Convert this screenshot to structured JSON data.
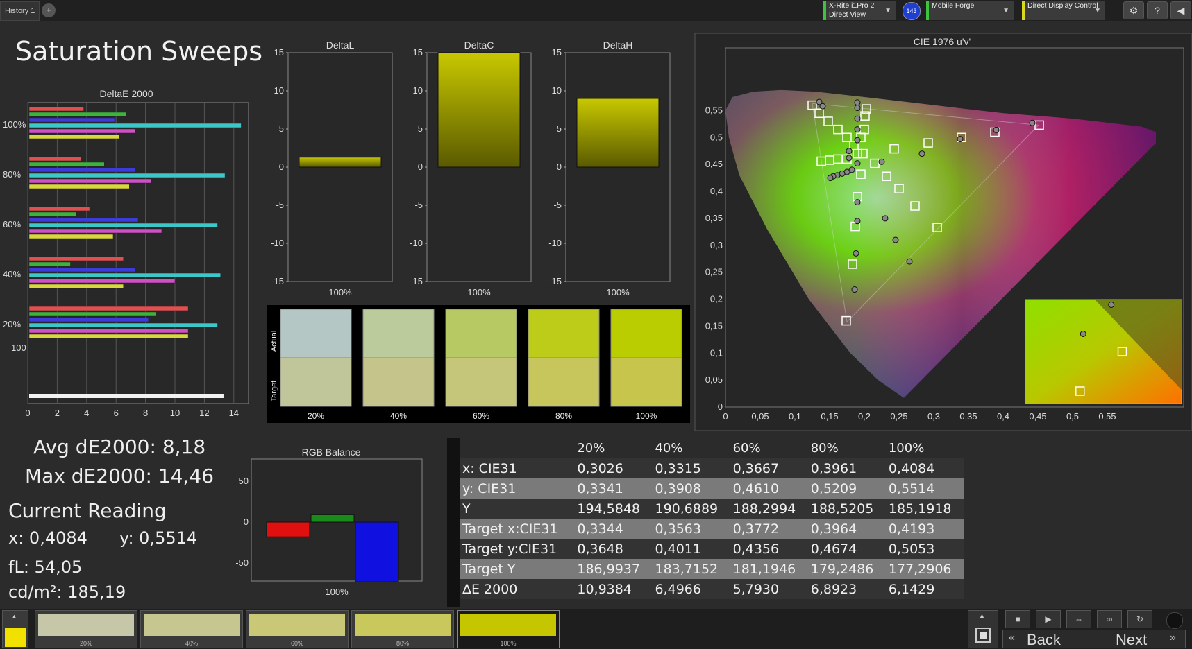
{
  "top": {
    "tab_label": "History 1",
    "tab_add": "+",
    "devices": [
      {
        "line1": "X-Rite i1Pro 2",
        "line2": "Direct View"
      },
      {
        "line1": "Mobile Forge",
        "line2": ""
      },
      {
        "line1": "Direct Display Control",
        "line2": ""
      }
    ],
    "badge": "143",
    "settings_icon": "gear-icon",
    "help_label": "?",
    "back_label": "◀"
  },
  "page": {
    "title": "Saturation Sweeps"
  },
  "de_chart": {
    "title": "DeltaE 2000",
    "type": "bar",
    "xticks": [
      "0",
      "2",
      "4",
      "6",
      "8",
      "10",
      "12",
      "14"
    ],
    "xlim": [
      0,
      15
    ],
    "group_labels": [
      "100%",
      "80%",
      "60%",
      "40%",
      "20%",
      "100"
    ],
    "series_colors": [
      "#e05050",
      "#3cb43c",
      "#3c3cd8",
      "#3cc8c8",
      "#d050c8",
      "#d8d83c"
    ],
    "groups": [
      {
        "label": "100%",
        "values": [
          3.8,
          6.7,
          5.9,
          14.5,
          7.3,
          6.2
        ]
      },
      {
        "label": "80%",
        "values": [
          3.6,
          5.2,
          7.3,
          13.4,
          8.4,
          6.9
        ]
      },
      {
        "label": "60%",
        "values": [
          4.2,
          3.3,
          7.5,
          12.9,
          9.1,
          5.8
        ]
      },
      {
        "label": "40%",
        "values": [
          6.5,
          2.9,
          7.3,
          13.1,
          10.0,
          6.5
        ]
      },
      {
        "label": "20%",
        "values": [
          10.9,
          8.7,
          8.2,
          12.9,
          10.9,
          10.9
        ]
      }
    ],
    "white_value": 13.3
  },
  "delta_charts": [
    {
      "title": "DeltaL",
      "value": 1.3,
      "label": "100%"
    },
    {
      "title": "DeltaC",
      "value": 15,
      "label": "100%"
    },
    {
      "title": "DeltaH",
      "value": 9,
      "label": "100%"
    }
  ],
  "delta_yticks": [
    "15",
    "10",
    "5",
    "0",
    "-5",
    "-10",
    "-15"
  ],
  "swatches": {
    "row_actual": "Actual",
    "row_target": "Target",
    "items": [
      {
        "label": "20%",
        "actual": "#b4c7c4",
        "target": "#c1c59a"
      },
      {
        "label": "40%",
        "actual": "#bccb9b",
        "target": "#c4c48b"
      },
      {
        "label": "60%",
        "actual": "#b7c962",
        "target": "#c5c67a"
      },
      {
        "label": "80%",
        "actual": "#bccc19",
        "target": "#c7c65c"
      },
      {
        "label": "100%",
        "actual": "#b9cd00",
        "target": "#c7c54c"
      }
    ]
  },
  "cie": {
    "title": "CIE 1976 u'v'",
    "xticks": [
      "0",
      "0,05",
      "0,1",
      "0,15",
      "0,2",
      "0,25",
      "0,3",
      "0,35",
      "0,4",
      "0,45",
      "0,5",
      "0,55"
    ],
    "yticks": [
      "0",
      "0,05",
      "0,1",
      "0,15",
      "0,2",
      "0,25",
      "0,3",
      "0,35",
      "0,4",
      "0,45",
      "0,5",
      "0,55"
    ],
    "targets": [
      [
        0.125,
        0.56
      ],
      [
        0.135,
        0.545
      ],
      [
        0.148,
        0.53
      ],
      [
        0.162,
        0.515
      ],
      [
        0.175,
        0.5
      ],
      [
        0.185,
        0.485
      ],
      [
        0.19,
        0.47
      ],
      [
        0.195,
        0.5
      ],
      [
        0.2,
        0.515
      ],
      [
        0.201,
        0.54
      ],
      [
        0.203,
        0.553
      ],
      [
        0.198,
        0.47
      ],
      [
        0.175,
        0.46
      ],
      [
        0.162,
        0.46
      ],
      [
        0.15,
        0.458
      ],
      [
        0.138,
        0.456
      ],
      [
        0.215,
        0.452
      ],
      [
        0.243,
        0.479
      ],
      [
        0.292,
        0.49
      ],
      [
        0.34,
        0.5
      ],
      [
        0.388,
        0.51
      ],
      [
        0.452,
        0.523
      ],
      [
        0.195,
        0.432
      ],
      [
        0.232,
        0.428
      ],
      [
        0.25,
        0.405
      ],
      [
        0.273,
        0.373
      ],
      [
        0.305,
        0.333
      ],
      [
        0.19,
        0.39
      ],
      [
        0.187,
        0.335
      ],
      [
        0.183,
        0.265
      ],
      [
        0.174,
        0.16
      ]
    ],
    "measured": [
      [
        0.135,
        0.566
      ],
      [
        0.14,
        0.558
      ],
      [
        0.19,
        0.565
      ],
      [
        0.19,
        0.555
      ],
      [
        0.19,
        0.535
      ],
      [
        0.19,
        0.515
      ],
      [
        0.19,
        0.495
      ],
      [
        0.178,
        0.475
      ],
      [
        0.178,
        0.462
      ],
      [
        0.19,
        0.452
      ],
      [
        0.182,
        0.44
      ],
      [
        0.175,
        0.436
      ],
      [
        0.168,
        0.433
      ],
      [
        0.161,
        0.43
      ],
      [
        0.155,
        0.428
      ],
      [
        0.151,
        0.425
      ],
      [
        0.19,
        0.38
      ],
      [
        0.19,
        0.345
      ],
      [
        0.188,
        0.285
      ],
      [
        0.186,
        0.218
      ],
      [
        0.225,
        0.455
      ],
      [
        0.283,
        0.47
      ],
      [
        0.338,
        0.497
      ],
      [
        0.39,
        0.514
      ],
      [
        0.442,
        0.527
      ],
      [
        0.23,
        0.35
      ],
      [
        0.245,
        0.31
      ],
      [
        0.265,
        0.27
      ]
    ],
    "zoom_target_points": [
      [
        0.62,
        0.5
      ],
      [
        0.35,
        0.88
      ]
    ],
    "zoom_measured_points": [
      [
        0.55,
        0.05
      ],
      [
        0.37,
        0.33
      ]
    ]
  },
  "stats": {
    "avg": "Avg dE2000: 8,18",
    "max": "Max dE2000: 14,46",
    "current_title": "Current Reading",
    "x": "x: 0,4084",
    "y": "y: 0,5514",
    "fl": "fL: 54,05",
    "cdm": "cd/m²: 185,19"
  },
  "rgb": {
    "title": "RGB Balance",
    "yticks": [
      "50",
      "0",
      "-50"
    ],
    "label": "100%",
    "values": [
      {
        "color": "#e01010",
        "value": -18
      },
      {
        "color": "#1a8a1a",
        "value": 9
      },
      {
        "color": "#1010e0",
        "value": -73
      }
    ]
  },
  "table": {
    "headers": [
      "",
      "20%",
      "40%",
      "60%",
      "80%",
      "100%"
    ],
    "rows": [
      [
        "x: CIE31",
        "0,3026",
        "0,3315",
        "0,3667",
        "0,3961",
        "0,4084"
      ],
      [
        "y: CIE31",
        "0,3341",
        "0,3908",
        "0,4610",
        "0,5209",
        "0,5514"
      ],
      [
        "Y",
        "194,5848",
        "190,6889",
        "188,2994",
        "188,5205",
        "185,1918"
      ],
      [
        "Target x:CIE31",
        "0,3344",
        "0,3563",
        "0,3772",
        "0,3964",
        "0,4193"
      ],
      [
        "Target y:CIE31",
        "0,3648",
        "0,4011",
        "0,4356",
        "0,4674",
        "0,5053"
      ],
      [
        "Target Y",
        "186,9937",
        "183,7152",
        "181,1946",
        "179,2486",
        "177,2906"
      ],
      [
        "ΔE 2000",
        "10,9384",
        "6,4966",
        "5,7930",
        "6,8923",
        "6,1429"
      ]
    ]
  },
  "bottom": {
    "current_swatch": "#f2e000",
    "patches": [
      {
        "label": "20%",
        "color": "#c6c6a8"
      },
      {
        "label": "40%",
        "color": "#c6c690"
      },
      {
        "label": "60%",
        "color": "#c8c877"
      },
      {
        "label": "80%",
        "color": "#c8c85c"
      },
      {
        "label": "100%",
        "color": "#c5c500"
      }
    ],
    "back": "Back",
    "next": "Next"
  }
}
